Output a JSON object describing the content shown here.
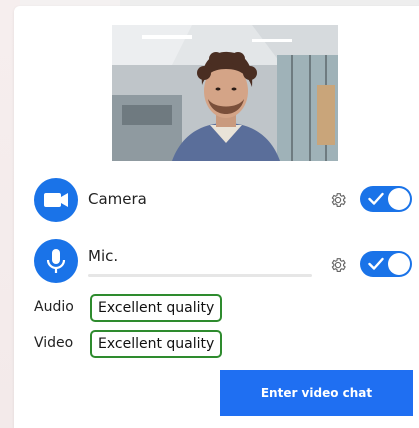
{
  "devices": {
    "camera": {
      "label": "Camera",
      "enabled": true,
      "icon": "video-camera-icon"
    },
    "mic": {
      "label": "Mic.",
      "enabled": true,
      "icon": "microphone-icon",
      "level": 0
    }
  },
  "quality": {
    "audio": {
      "label": "Audio",
      "status": "Excellent quality"
    },
    "video": {
      "label": "Video",
      "status": "Excellent quality"
    }
  },
  "actions": {
    "enter_label": "Enter video chat"
  },
  "colors": {
    "accent": "#1a73e8",
    "quality_good": "#2e8b2e",
    "button": "#1f6ff2"
  }
}
